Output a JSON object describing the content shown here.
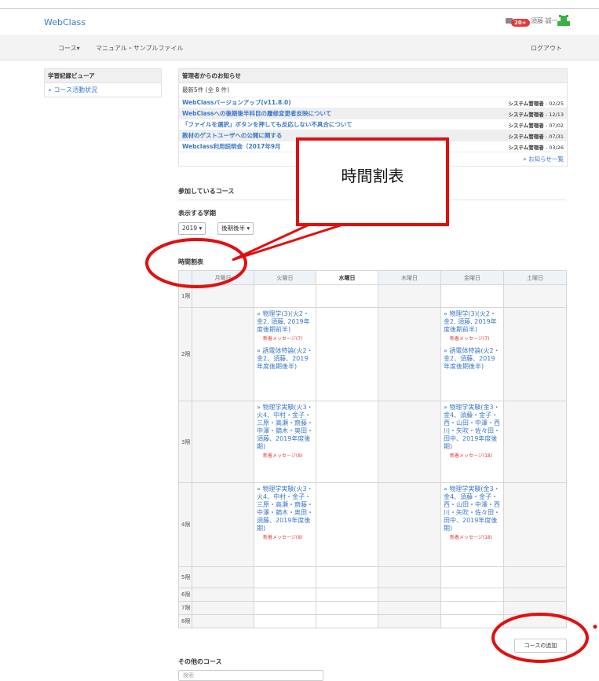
{
  "app": {
    "brand": "WebClass",
    "notification_count": "20+",
    "user_name": "須藤 誠一"
  },
  "nav": {
    "courses": "コース▾",
    "manual": "マニュアル・サンプルファイル",
    "logout": "ログアウト"
  },
  "sidebar": {
    "title": "学習記録ビューア",
    "items": [
      {
        "label": "» コース活動状況"
      }
    ]
  },
  "news": {
    "title": "管理者からのお知らせ",
    "subtitle": "最新5件 (全 8 件)",
    "items": [
      {
        "title": "WebClassバージョンアップ(v11.8.0)",
        "author": "システム管理者",
        "date": " - 02/25"
      },
      {
        "title": "WebClassへの後期後半科目の履修変更者反映について",
        "author": "システム管理者",
        "date": " - 12/13"
      },
      {
        "title": "「ファイルを選択」ボタンを押しても反応しない不具合について",
        "author": "システム管理者",
        "date": " - 07/02"
      },
      {
        "title": "教材のゲストユーザへの公開に関する",
        "author": "システム管理者",
        "date": " - 07/31"
      },
      {
        "title": "Webclass利用説明会（2017年9月",
        "author": "システム管理者",
        "date": " - 03/26"
      }
    ],
    "more": "» お知らせ一覧"
  },
  "participating": {
    "title": "参加しているコース"
  },
  "term": {
    "label": "表示する学期",
    "year": "2019",
    "semester": "後期後半"
  },
  "timetable": {
    "title": "時間割表",
    "days": [
      "月曜日",
      "火曜日",
      "水曜日",
      "木曜日",
      "金曜日",
      "土曜日"
    ],
    "periods": [
      "1限",
      "2限",
      "3限",
      "4限",
      "5限",
      "6限",
      "7限",
      "8限"
    ],
    "course_physics": "» 物理学(3)(火2・金2, 須藤, 2019年度後期前半)",
    "course_dielectric": "» 誘電体特論(火2・金2、須藤、2019年度後期後半)",
    "course_lab_tue": "» 物理学実験(火3・火4、中村・金子・三原・高瀬・齋藤・中澤・鏑木・奥田・須藤、2019年度後期)",
    "course_lab_fri": "» 物理学実験(金3・金4、須藤・金子・西・山田・中澤・西川・矢吹・佐々田・田中、2019年度後期)",
    "msg7": "新着メッセージ(7)",
    "msg8": "新着メッセージ(8)",
    "msg18": "新着メッセージ(18)"
  },
  "add_course_button": "コースの追加",
  "other_courses": {
    "title": "その他のコース",
    "search_placeholder": "検索"
  },
  "annotation": {
    "callout_text": "時間割表",
    "color": "#e01010"
  }
}
